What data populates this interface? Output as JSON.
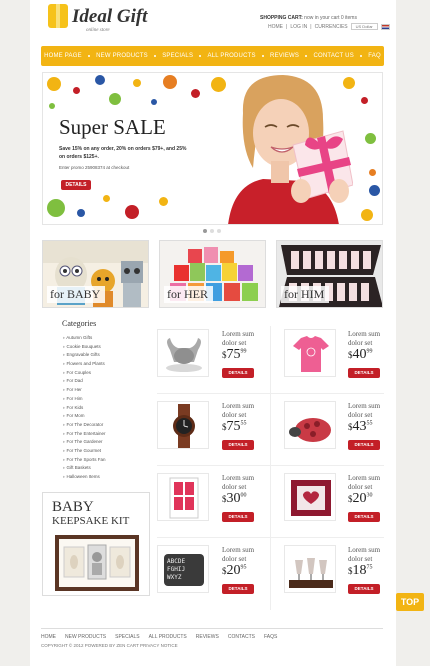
{
  "header": {
    "logo_title": "Ideal Gift",
    "logo_subtitle": "online store",
    "cart_label": "SHOPPING CART:",
    "cart_status": "now in your cart 0 items",
    "top_links": [
      "HOME",
      "LOG IN",
      "CURRENCIES"
    ],
    "currency_value": "US Dollar"
  },
  "nav": {
    "items": [
      "HOME PAGE",
      "NEW PRODUCTS",
      "SPECIALS",
      "ALL PRODUCTS",
      "REVIEWS",
      "CONTACT US",
      "FAQ"
    ]
  },
  "banner": {
    "title_a": "Super ",
    "title_b": "SALE",
    "text": "Save 15% on any order, 20% on orders $79+, and 25% on orders $125+.",
    "promo": "Enter promo 25908374 at checkout",
    "button": "DETAILS",
    "slides": 3,
    "active_slide": 1
  },
  "tiles": [
    {
      "label": "for BABY"
    },
    {
      "label": "for HER"
    },
    {
      "label": "for HIM"
    }
  ],
  "sidebar": {
    "title": "Categories",
    "items": [
      "Autumn Gifts",
      "Cookie Bouquets",
      "Engravable Gifts",
      "Flowers and Plants",
      "For Couples",
      "For Dad",
      "For Her",
      "For Him",
      "For Kids",
      "For Mom",
      "For The Decorator",
      "For The Entertainer",
      "For The Gardener",
      "For The Gourmet",
      "For The Sports Fan",
      "Gift Baskets",
      "Halloween Items"
    ],
    "promo_line1": "BABY",
    "promo_line2": "KEEPSAKE KIT"
  },
  "products": [
    {
      "name": "Lorem sum dolor set",
      "currency": "$",
      "whole": "75",
      "cents": "99",
      "button": "DETAILS"
    },
    {
      "name": "Lorem sum dolor set",
      "currency": "$",
      "whole": "40",
      "cents": "99",
      "button": "DETAILS"
    },
    {
      "name": "Lorem sum dolor set",
      "currency": "$",
      "whole": "75",
      "cents": "55",
      "button": "DETAILS"
    },
    {
      "name": "Lorem sum dolor set",
      "currency": "$",
      "whole": "43",
      "cents": "55",
      "button": "DETAILS"
    },
    {
      "name": "Lorem sum dolor set",
      "currency": "$",
      "whole": "30",
      "cents": "00",
      "button": "DETAILS"
    },
    {
      "name": "Lorem sum dolor set",
      "currency": "$",
      "whole": "20",
      "cents": "30",
      "button": "DETAILS"
    },
    {
      "name": "Lorem sum dolor set",
      "currency": "$",
      "whole": "20",
      "cents": "95",
      "button": "DETAILS"
    },
    {
      "name": "Lorem sum dolor set",
      "currency": "$",
      "whole": "18",
      "cents": "75",
      "button": "DETAILS"
    }
  ],
  "top_button": "TOP",
  "footer": {
    "links": [
      "HOME",
      "NEW PRODUCTS",
      "SPECIALS",
      "ALL PRODUCTS",
      "REVIEWS",
      "CONTACTS",
      "FAQS"
    ],
    "copyright": "COPYRIGHT © 2012 POWERED BY ZEN CART PRIVACY NOTICE"
  },
  "colors": {
    "accent": "#f2b413",
    "button": "#c31f27",
    "background": "#f0efec"
  }
}
